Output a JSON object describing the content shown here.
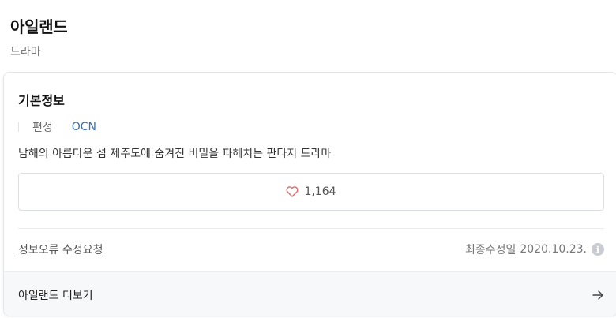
{
  "header": {
    "title": "아일랜드",
    "genre": "드라마"
  },
  "basic_info": {
    "section_title": "기본정보",
    "broadcaster_key": "편성",
    "broadcaster_value": "OCN",
    "description": "남해의 아름다운 섬 제주도에 숨겨진 비밀을 파헤치는 판타지 드라마"
  },
  "like": {
    "icon": "heart-icon",
    "count": "1,164",
    "color": "#e0686b"
  },
  "footer": {
    "report_link": "정보오류 수정요청",
    "updated_label": "최종수정일",
    "updated_date": "2020.10.23.",
    "info_icon": "info-icon"
  },
  "more": {
    "label": "아일랜드 더보기",
    "icon": "arrow-right-icon"
  }
}
